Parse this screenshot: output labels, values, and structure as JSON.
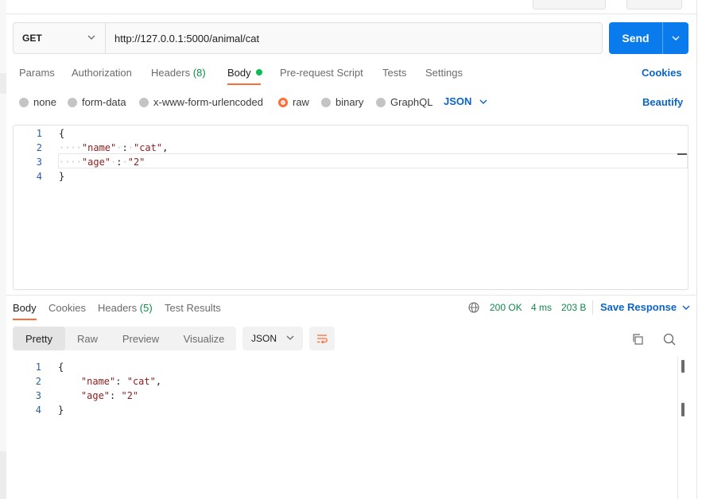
{
  "request": {
    "method": "GET",
    "url": "http://127.0.0.1:5000/animal/cat",
    "send_label": "Send"
  },
  "request_tabs": {
    "params": "Params",
    "authorization": "Authorization",
    "headers": "Headers",
    "headers_count": "(8)",
    "body": "Body",
    "prerequest": "Pre-request Script",
    "tests": "Tests",
    "settings": "Settings",
    "cookies": "Cookies"
  },
  "body_types": {
    "none": "none",
    "form_data": "form-data",
    "urlencoded": "x-www-form-urlencoded",
    "raw": "raw",
    "binary": "binary",
    "graphql": "GraphQL",
    "language": "JSON",
    "beautify": "Beautify",
    "selected": "raw"
  },
  "request_body": {
    "line_numbers": [
      "1",
      "2",
      "3",
      "4"
    ],
    "open_brace": "{",
    "close_brace": "}",
    "key1": "\"name\"",
    "val1": "\"cat\"",
    "key2": "\"age\"",
    "val2": "\"2\""
  },
  "response_tabs": {
    "body": "Body",
    "cookies": "Cookies",
    "headers": "Headers",
    "headers_count": "(5)",
    "test_results": "Test Results"
  },
  "response_meta": {
    "status": "200 OK",
    "time": "4 ms",
    "size": "203 B",
    "save_response": "Save Response"
  },
  "response_view": {
    "pretty": "Pretty",
    "raw": "Raw",
    "preview": "Preview",
    "visualize": "Visualize",
    "format": "JSON"
  },
  "response_body": {
    "line_numbers": [
      "1",
      "2",
      "3",
      "4"
    ],
    "open_brace": "{",
    "close_brace": "}",
    "key1": "\"name\"",
    "val1": "\"cat\"",
    "key2": "\"age\"",
    "val2": "\"2\""
  },
  "colors": {
    "accent": "#ff6c37",
    "send": "#097bed",
    "link": "#0b64c8",
    "status_ok": "#0e8a49",
    "body_dot": "#0cbb52"
  }
}
